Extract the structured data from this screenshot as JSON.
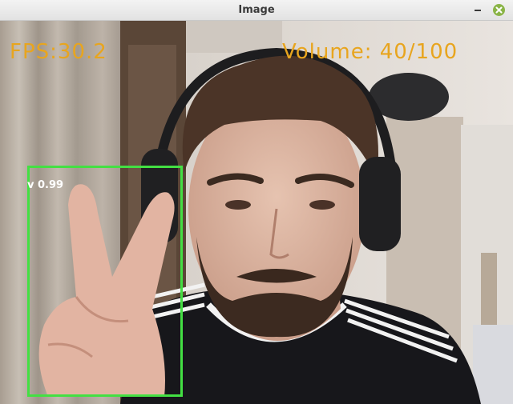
{
  "window": {
    "title": "Image"
  },
  "overlay": {
    "fps_text": "FPS:30.2",
    "volume_text": "Volume: 40/100",
    "text_color": "#e8a51e"
  },
  "detection": {
    "label": "v 0.99",
    "box_color": "#43e043"
  },
  "icons": {
    "minimize": "minimize-icon",
    "close": "close-icon"
  }
}
